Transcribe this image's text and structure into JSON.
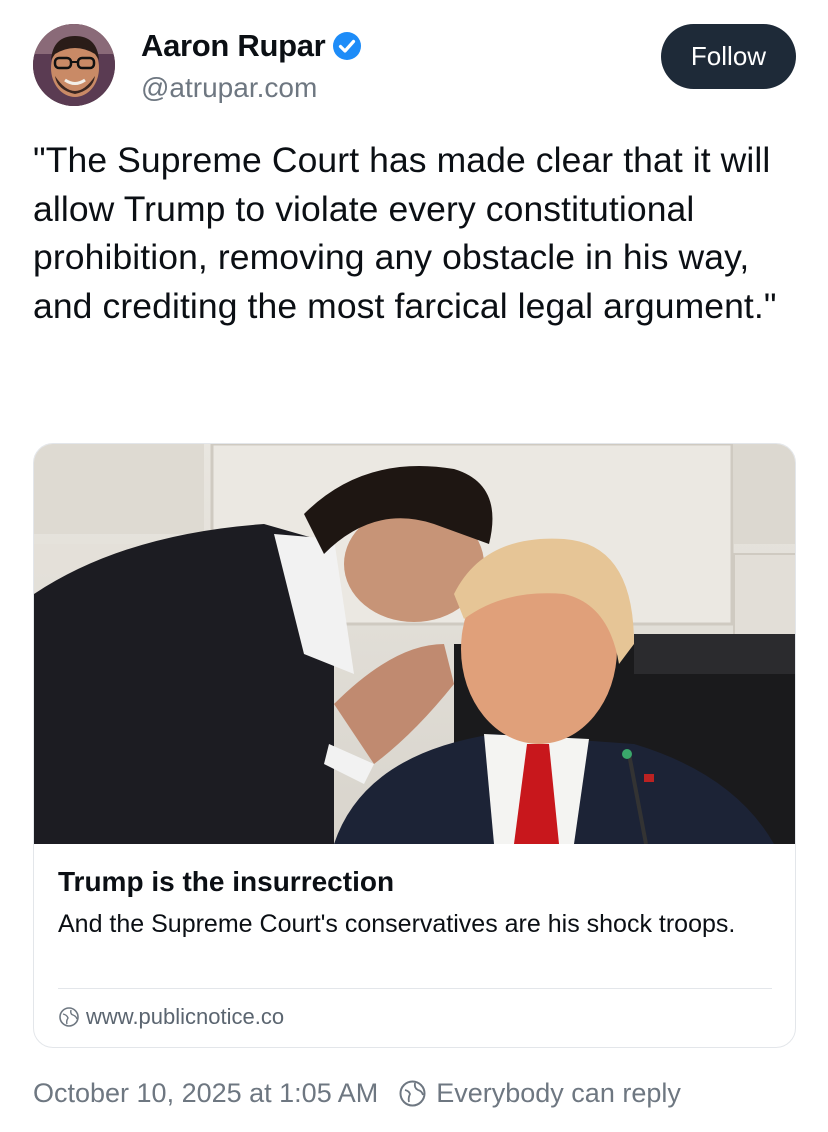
{
  "author": {
    "display_name": "Aaron Rupar",
    "handle": "@atrupar.com",
    "avatar_icon": "avatar",
    "verified_icon": "verified-badge-icon",
    "verified_color": "#1d8cf8"
  },
  "follow_button": {
    "label": "Follow",
    "background": "#1e2a38"
  },
  "post": {
    "text": "\"The Supreme Court has made clear that it will allow Trump to violate every constitutional prohibition, removing any obstacle in his way, and crediting the most farcical legal argument.\""
  },
  "link_card": {
    "image_icon": "article-photo",
    "title": "Trump is the insurrection",
    "description": "And the Supreme Court's conservatives are his shock troops.",
    "source_icon": "globe-icon",
    "source": "www.publicnotice.co"
  },
  "footer": {
    "timestamp": "October 10, 2025 at 1:05 AM",
    "reply_icon": "reply-settings-icon",
    "reply_setting": "Everybody can reply"
  }
}
